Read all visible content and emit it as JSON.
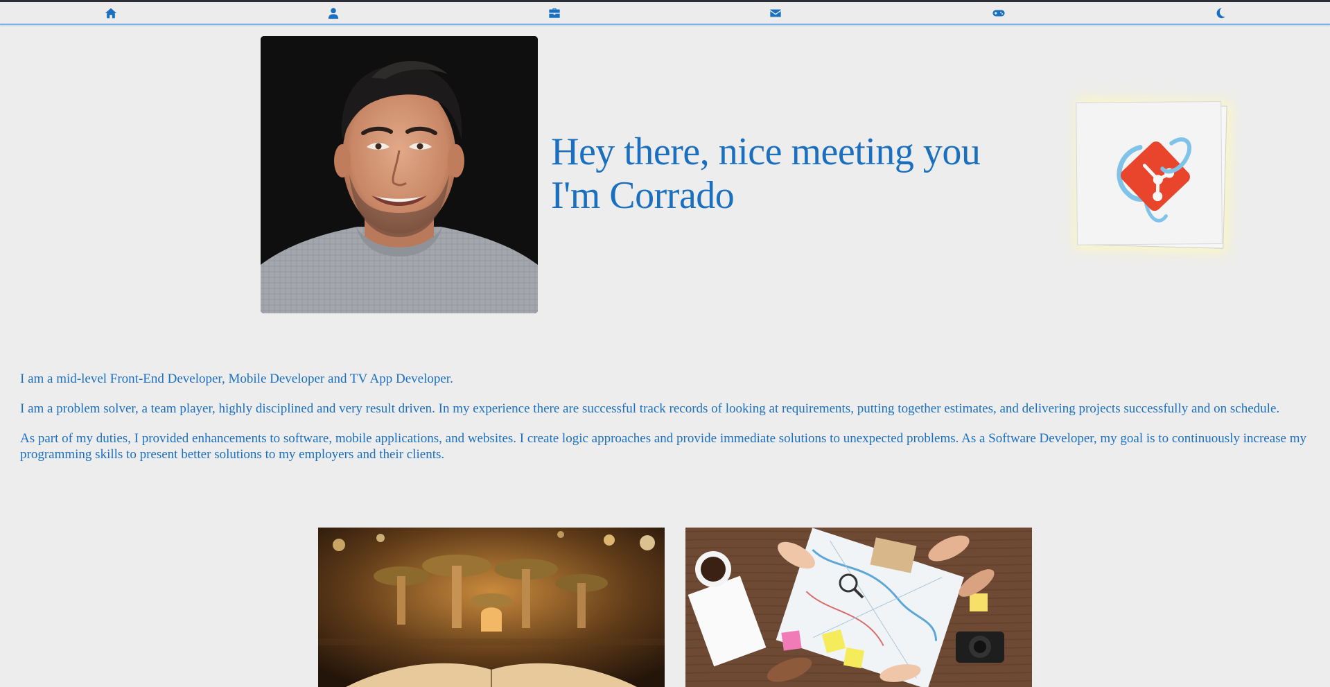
{
  "nav": {
    "items": [
      {
        "icon": "home-icon",
        "label": "Home"
      },
      {
        "icon": "user-icon",
        "label": "About"
      },
      {
        "icon": "briefcase-icon",
        "label": "Work"
      },
      {
        "icon": "envelope-icon",
        "label": "Contact"
      },
      {
        "icon": "gamepad-icon",
        "label": "Games"
      },
      {
        "icon": "moon-icon",
        "label": "Dark mode"
      }
    ],
    "accent": "#1b6fbf"
  },
  "hero": {
    "title_line1": "Hey there,  nice meeting you",
    "title_line2": "I'm Corrado",
    "logo_icon": "git-icon"
  },
  "about": {
    "paragraphs": [
      "I am a mid-level Front-End Developer, Mobile Developer and TV App Developer.",
      "I am a problem solver, a team player, highly disciplined and very result driven. In my experience there are successful track records of looking at requirements, putting together estimates, and delivering projects successfully and on schedule.",
      "As part of my duties, I provided enhancements to software, mobile applications, and websites. I create logic approaches and provide immediate solutions to unexpected problems. As a Software Developer, my goal is to continuously increase my programming skills to present better solutions to my employers and their clients."
    ]
  },
  "colors": {
    "background": "#ededed",
    "text": "#1b6fbf",
    "git_red": "#e8452c",
    "git_blue": "#7fc4e8"
  }
}
